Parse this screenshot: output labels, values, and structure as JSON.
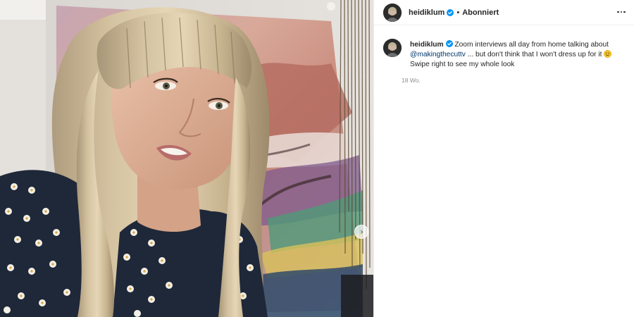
{
  "post": {
    "username": "heidiklum",
    "follow_state": "Abonniert",
    "separator": "•",
    "caption": {
      "username": "heidiklum",
      "text_before_mention": "Zoom interviews all day from home talking about",
      "mention": "@makingthecuttv",
      "text_after_mention": "... but don't think that I won't dress up for it",
      "emoji": "slightly-smiling-face",
      "text_line3": "Swipe right to see my whole look"
    },
    "timestamp": "18 Wo."
  },
  "icons": {
    "verified": "verified-badge-icon",
    "more": "more-options-icon",
    "next": "chevron-right-icon"
  },
  "colors": {
    "verified_blue": "#0095f6",
    "mention_blue": "#00376b",
    "muted_text": "#8e8e8e"
  }
}
